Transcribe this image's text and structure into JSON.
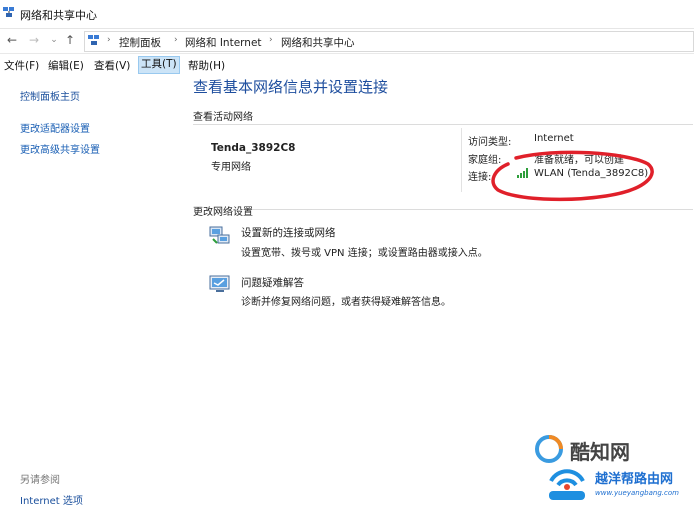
{
  "window": {
    "title": "网络和共享中心"
  },
  "address": {
    "crumbs": [
      "控制面板",
      "网络和 Internet",
      "网络和共享中心"
    ]
  },
  "menu": {
    "items": [
      "文件(F)",
      "编辑(E)",
      "查看(V)",
      "工具(T)",
      "帮助(H)"
    ],
    "active_index": 3
  },
  "sidebar": {
    "home": "控制面板主页",
    "links": [
      "更改适配器设置",
      "更改高级共享设置"
    ],
    "see_also_title": "另请参阅",
    "see_also": [
      "Internet 选项"
    ]
  },
  "main": {
    "title": "查看基本网络信息并设置连接",
    "active_title": "查看活动网络",
    "network_name": "Tenda_3892C8",
    "network_type": "专用网络",
    "access_label": "访问类型:",
    "access_value": "Internet",
    "homegroup_label": "家庭组:",
    "homegroup_value": "准备就绪，可以创建",
    "connection_label": "连接:",
    "connection_value": "WLAN (Tenda_3892C8)",
    "change_title": "更改网络设置",
    "tasks": [
      {
        "title": "设置新的连接或网络",
        "desc": "设置宽带、拨号或 VPN 连接；或设置路由器或接入点。",
        "icon": "network-setup-icon"
      },
      {
        "title": "问题疑难解答",
        "desc": "诊断并修复网络问题，或者获得疑难解答信息。",
        "icon": "troubleshoot-icon"
      }
    ]
  },
  "watermarks": {
    "logo1": "酷知网",
    "logo2": "越洋帮路由网",
    "url": "www.yueyangbang.com"
  }
}
